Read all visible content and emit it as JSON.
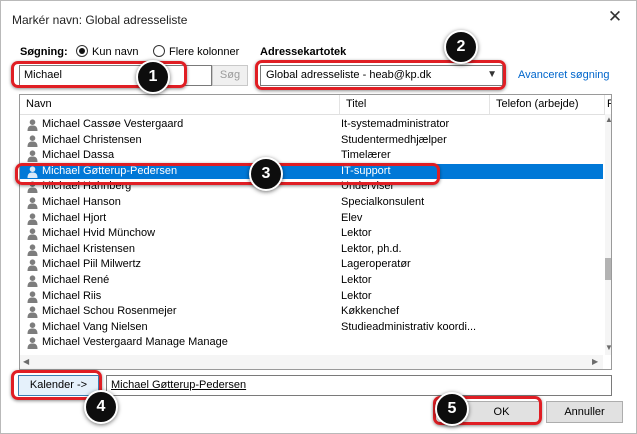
{
  "window": {
    "title": "Markér navn: Global adresseliste"
  },
  "search": {
    "label": "Søgning:",
    "option_name": "Kun navn",
    "option_columns": "Flere kolonner",
    "value": "Michael",
    "button": "Søg"
  },
  "addressbook": {
    "label": "Adressekartotek",
    "selected": "Global adresseliste - heab@kp.dk",
    "advanced_link": "Avanceret søgning"
  },
  "table": {
    "columns": [
      "Navn",
      "Titel",
      "Telefon (arbejde)",
      "P"
    ],
    "rows": [
      {
        "name": "Michael Cassøe Vestergaard",
        "title": "It-systemadministrator"
      },
      {
        "name": "Michael Christensen",
        "title": "Studentermedhjælper"
      },
      {
        "name": "Michael Dassa",
        "title": "Timelærer"
      },
      {
        "name": "Michael Gøtterup-Pedersen",
        "title": "IT-support"
      },
      {
        "name": "Michael Hahnberg",
        "title": "Underviser"
      },
      {
        "name": "Michael Hanson",
        "title": "Specialkonsulent"
      },
      {
        "name": "Michael Hjort",
        "title": "Elev"
      },
      {
        "name": "Michael Hvid Münchow",
        "title": "Lektor"
      },
      {
        "name": "Michael Kristensen",
        "title": "Lektor, ph.d."
      },
      {
        "name": "Michael Piil Milwertz",
        "title": "Lageroperatør"
      },
      {
        "name": "Michael René",
        "title": "Lektor"
      },
      {
        "name": "Michael Riis",
        "title": "Lektor"
      },
      {
        "name": "Michael Schou Rosenmejer",
        "title": "Køkkenchef"
      },
      {
        "name": "Michael Vang Nielsen",
        "title": "Studieadministrativ koordi..."
      },
      {
        "name": "Michael Vestergaard Manage Manage",
        "title": ""
      }
    ],
    "selected_index": 3
  },
  "bottom": {
    "calendar_button": "Kalender ->",
    "selected_value": "Michael Gøtterup-Pedersen",
    "ok": "OK",
    "cancel": "Annuller"
  },
  "callouts": [
    "1",
    "2",
    "3",
    "4",
    "5"
  ],
  "colors": {
    "highlight": "#e01e24",
    "selection": "#0078d7",
    "link": "#0066cc"
  }
}
